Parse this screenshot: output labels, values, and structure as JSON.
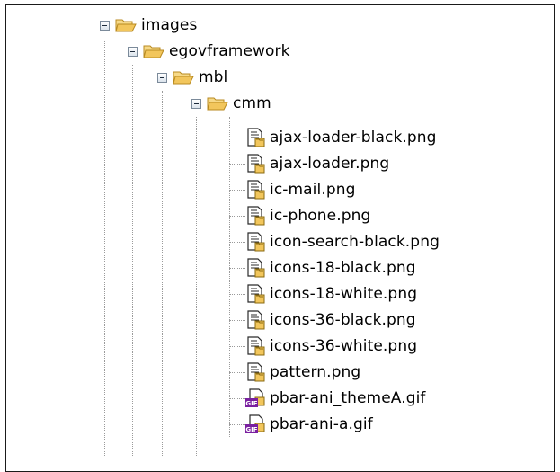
{
  "tree": {
    "folders": [
      {
        "label": "images",
        "icon": "folder-open-icon",
        "expanded": true
      },
      {
        "label": "egovframework",
        "icon": "folder-open-icon",
        "expanded": true
      },
      {
        "label": "mbl",
        "icon": "folder-open-icon",
        "expanded": true
      },
      {
        "label": "cmm",
        "icon": "folder-open-icon",
        "expanded": true
      }
    ],
    "files": [
      {
        "label": "ajax-loader-black.png",
        "icon": "png-file-icon"
      },
      {
        "label": "ajax-loader.png",
        "icon": "png-file-icon"
      },
      {
        "label": "ic-mail.png",
        "icon": "png-file-icon"
      },
      {
        "label": "ic-phone.png",
        "icon": "png-file-icon"
      },
      {
        "label": "icon-search-black.png",
        "icon": "png-file-icon"
      },
      {
        "label": "icons-18-black.png",
        "icon": "png-file-icon"
      },
      {
        "label": "icons-18-white.png",
        "icon": "png-file-icon"
      },
      {
        "label": "icons-36-black.png",
        "icon": "png-file-icon"
      },
      {
        "label": "icons-36-white.png",
        "icon": "png-file-icon"
      },
      {
        "label": "pattern.png",
        "icon": "png-file-icon"
      },
      {
        "label": "pbar-ani_themeA.gif",
        "icon": "gif-file-icon",
        "badge": "GIF"
      },
      {
        "label": "pbar-ani-a.gif",
        "icon": "gif-file-icon",
        "badge": "GIF"
      }
    ]
  },
  "colors": {
    "folder": "#f2c65c",
    "folder_dark": "#b88a20",
    "gif_badge": "#7a1fa0",
    "tree_line": "#9a9a9a"
  }
}
